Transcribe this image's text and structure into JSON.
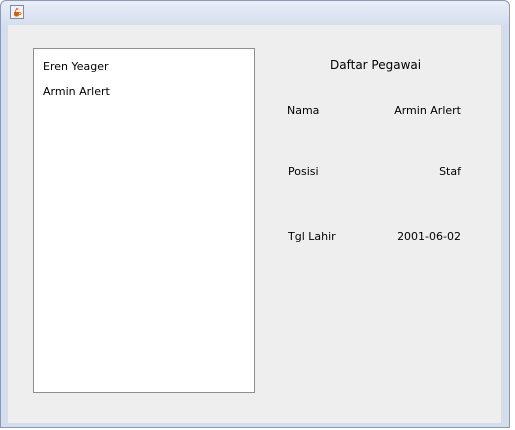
{
  "window": {
    "icon": "java-cup-icon"
  },
  "employee_list": {
    "items": [
      {
        "label": "Eren Yeager"
      },
      {
        "label": "Armin Arlert"
      }
    ]
  },
  "details": {
    "title": "Daftar Pegawai",
    "fields": [
      {
        "label": "Nama",
        "value": "Armin Arlert"
      },
      {
        "label": "Posisi",
        "value": "Staf"
      },
      {
        "label": "Tgl Lahir",
        "value": "2001-06-02"
      }
    ]
  }
}
